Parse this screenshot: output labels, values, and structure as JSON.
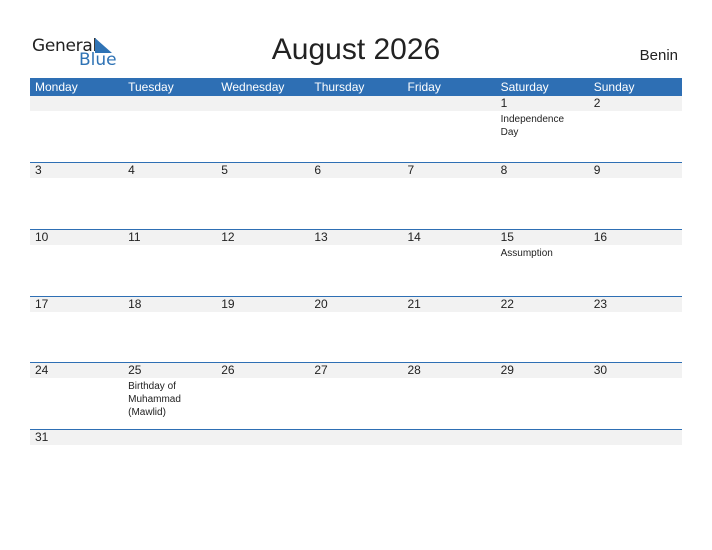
{
  "logo": {
    "general": "General",
    "blue": "Blue"
  },
  "title": "August 2026",
  "country": "Benin",
  "accent_color": "#2e6fb4",
  "weekdays": [
    "Monday",
    "Tuesday",
    "Wednesday",
    "Thursday",
    "Friday",
    "Saturday",
    "Sunday"
  ],
  "weeks": [
    [
      {
        "d": ""
      },
      {
        "d": ""
      },
      {
        "d": ""
      },
      {
        "d": ""
      },
      {
        "d": ""
      },
      {
        "d": "1",
        "e": "Independence Day"
      },
      {
        "d": "2"
      }
    ],
    [
      {
        "d": "3"
      },
      {
        "d": "4"
      },
      {
        "d": "5"
      },
      {
        "d": "6"
      },
      {
        "d": "7"
      },
      {
        "d": "8"
      },
      {
        "d": "9"
      }
    ],
    [
      {
        "d": "10"
      },
      {
        "d": "11"
      },
      {
        "d": "12"
      },
      {
        "d": "13"
      },
      {
        "d": "14"
      },
      {
        "d": "15",
        "e": "Assumption"
      },
      {
        "d": "16"
      }
    ],
    [
      {
        "d": "17"
      },
      {
        "d": "18"
      },
      {
        "d": "19"
      },
      {
        "d": "20"
      },
      {
        "d": "21"
      },
      {
        "d": "22"
      },
      {
        "d": "23"
      }
    ],
    [
      {
        "d": "24"
      },
      {
        "d": "25",
        "e": "Birthday of Muhammad (Mawlid)"
      },
      {
        "d": "26"
      },
      {
        "d": "27"
      },
      {
        "d": "28"
      },
      {
        "d": "29"
      },
      {
        "d": "30"
      }
    ],
    [
      {
        "d": "31"
      },
      {
        "d": ""
      },
      {
        "d": ""
      },
      {
        "d": ""
      },
      {
        "d": ""
      },
      {
        "d": ""
      },
      {
        "d": ""
      }
    ]
  ]
}
